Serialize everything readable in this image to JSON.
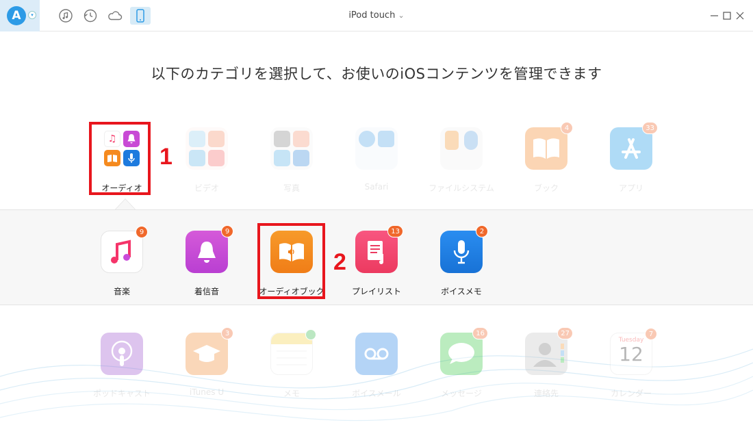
{
  "titlebar": {
    "logo_letter": "A",
    "device": "iPod touch",
    "device_caret": "⌄",
    "tools": [
      "music-note-icon",
      "restore-icon",
      "cloud-icon",
      "device-icon"
    ],
    "window_controls": [
      "minimize",
      "maximize",
      "close"
    ]
  },
  "heading": "以下のカテゴリを選択して、お使いのiOSコンテンツを管理できます",
  "categories": [
    {
      "label": "オーディオ",
      "badge": ""
    },
    {
      "label": "ビデオ",
      "badge": ""
    },
    {
      "label": "写真",
      "badge": ""
    },
    {
      "label": "Safari",
      "badge": ""
    },
    {
      "label": "ファイルシステム",
      "badge": ""
    },
    {
      "label": "ブック",
      "badge": "4"
    },
    {
      "label": "アプリ",
      "badge": "33"
    }
  ],
  "audio_items": [
    {
      "label": "音楽",
      "badge": "9"
    },
    {
      "label": "着信音",
      "badge": "9"
    },
    {
      "label": "オーディオブック",
      "badge": ""
    },
    {
      "label": "プレイリスト",
      "badge": "13"
    },
    {
      "label": "ボイスメモ",
      "badge": "2"
    }
  ],
  "bottom_items": [
    {
      "label": "ポッドキャスト",
      "badge": ""
    },
    {
      "label": "iTunes U",
      "badge": "3"
    },
    {
      "label": "メモ",
      "badge": ""
    },
    {
      "label": "ボイスメール",
      "badge": ""
    },
    {
      "label": "メッセージ",
      "badge": "16"
    },
    {
      "label": "連絡先",
      "badge": "27"
    },
    {
      "label": "カレンダー",
      "badge": "7"
    }
  ],
  "calendar": {
    "weekday": "Tuesday",
    "day": "12"
  },
  "annotations": {
    "step1": "1",
    "step2": "2"
  },
  "colors": {
    "accent": "#2d9be6",
    "badge": "#f0682b",
    "annotation": "#e8161d"
  }
}
